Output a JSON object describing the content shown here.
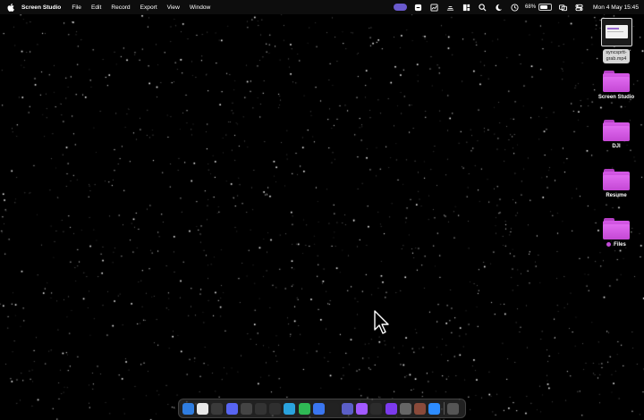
{
  "menubar": {
    "app_name": "Screen Studio",
    "menus": [
      "File",
      "Edit",
      "Record",
      "Export",
      "View",
      "Window"
    ],
    "status_icons": [
      "recording-pill-icon",
      "scribble-app-icon",
      "chart-app-icon",
      "network-icon",
      "window-tiling-icon",
      "search-icon",
      "dark-mode-icon",
      "clock-icon",
      "battery-icon",
      "screen-mirroring-icon",
      "control-center-icon"
    ],
    "battery_percent": "68%",
    "battery_level": 0.68,
    "datetime": "Mon 4 May  15:45"
  },
  "desktop": {
    "file_item": {
      "label_line1": "syncsprtt-",
      "label_line2": "grab.mp4"
    },
    "folders": [
      {
        "label": "Screen Studio",
        "tagged": false
      },
      {
        "label": "DJI",
        "tagged": false
      },
      {
        "label": "Resume",
        "tagged": false
      },
      {
        "label": "Files",
        "tagged": true
      }
    ],
    "tag_color": "#c24bd8",
    "folder_color": "#d559e6"
  },
  "dock": {
    "apps": [
      {
        "name": "finder-icon",
        "color": "#2f7de0",
        "glyph": ""
      },
      {
        "name": "mail-icon",
        "color": "#e8e8e8",
        "glyph": ""
      },
      {
        "name": "safari-icon",
        "color": "#3a3a3a",
        "glyph": ""
      },
      {
        "name": "discord-icon",
        "color": "#5865f2",
        "glyph": ""
      },
      {
        "name": "launchpad-icon",
        "color": "#444",
        "glyph": ""
      },
      {
        "name": "messages-icon",
        "color": "#333",
        "glyph": ""
      },
      {
        "name": "chrome-icon",
        "color": "#2f2f2f",
        "glyph": ""
      },
      {
        "name": "telegram-icon",
        "color": "#2aa3de",
        "glyph": ""
      },
      {
        "name": "whatsapp-icon",
        "color": "#2fb955",
        "glyph": ""
      },
      {
        "name": "signal-icon",
        "color": "#3a76f0",
        "glyph": ""
      },
      {
        "name": "github-icon",
        "color": "#222",
        "glyph": ""
      },
      {
        "name": "teams-icon",
        "color": "#5b5fc7",
        "glyph": ""
      },
      {
        "name": "figma-icon",
        "color": "#a259ff",
        "glyph": ""
      },
      {
        "name": "cursor-app-icon",
        "color": "#2c2c2c",
        "glyph": ""
      },
      {
        "name": "obsidian-icon",
        "color": "#7c3aed",
        "glyph": ""
      },
      {
        "name": "settings-icon",
        "color": "#666",
        "glyph": ""
      },
      {
        "name": "screen-studio-icon",
        "color": "#8a4a3a",
        "glyph": ""
      },
      {
        "name": "zoom-icon",
        "color": "#2d8cff",
        "glyph": ""
      },
      {
        "name": "trash-icon",
        "color": "#555",
        "glyph": ""
      }
    ]
  }
}
